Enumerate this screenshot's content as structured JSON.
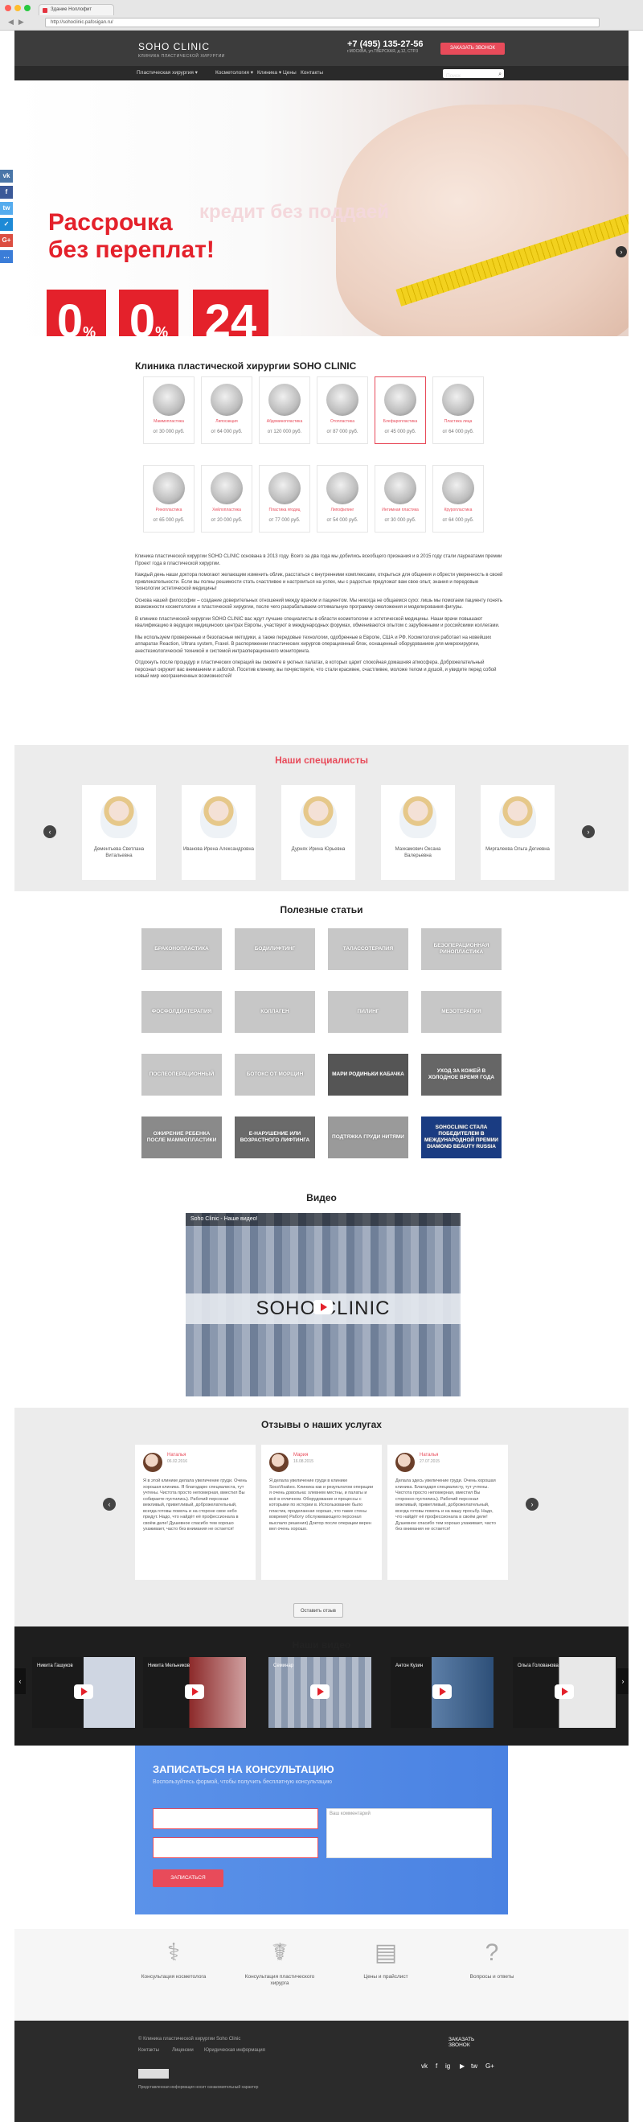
{
  "browser": {
    "tab": "Здание Ноллофит",
    "url": "http://sohoclinic.pafosigan.ru/"
  },
  "header": {
    "logo": "SOHO CLINIC",
    "logo_sub": "КЛИНИКА ПЛАСТИЧЕСКОЙ ХИРУРГИИ",
    "phone": "+7 (495) 135-27-56",
    "address": "г.МОСКВА, ул.ТВЕРСКАЯ, д.12, СТР.3",
    "call_button": "ЗАКАЗАТЬ ЗВОНОК"
  },
  "menu": {
    "items": [
      "Пластическая хирургия ▾",
      "Косметология ▾",
      "Клиника ▾",
      "Цены",
      "Контакты"
    ],
    "search_placeholder": "Поиск"
  },
  "hero": {
    "promo_line1": "Рассрочка",
    "promo_line2": "без переплат!",
    "faded": "кредит без поддаей",
    "boxes": [
      {
        "big": "0",
        "small": "%"
      },
      {
        "big": "0",
        "small": "%"
      },
      {
        "big": "24",
        "small": ""
      }
    ],
    "dots": "● ● ● ● ●",
    "social": [
      "vk",
      "f",
      "tw",
      "✓",
      "G+",
      "…"
    ],
    "social_colors": [
      "#4a76a8",
      "#3b5998",
      "#55acee",
      "#1e8ad6",
      "#dc4e41",
      "#3b7dd8"
    ]
  },
  "clinic": {
    "title": "Клиника пластической хирургии SOHO CLINIC",
    "services": [
      {
        "name": "Маммопластика",
        "price": "от 30 000 руб."
      },
      {
        "name": "Липосакция",
        "price": "от 64 000 руб."
      },
      {
        "name": "Абдоминопластика",
        "price": "от 120 000 руб."
      },
      {
        "name": "Отопластика",
        "price": "от 87 000 руб."
      },
      {
        "name": "Блефаропластика",
        "price": "от 45 000 руб."
      },
      {
        "name": "Пластика лица",
        "price": "от 64 000 руб."
      },
      {
        "name": "Ринопластика",
        "price": "от 65 000 руб."
      },
      {
        "name": "Хейлопластика",
        "price": "от 20 000 руб."
      },
      {
        "name": "Пластика ягодиц",
        "price": "от 77 000 руб."
      },
      {
        "name": "Липофилинг",
        "price": "от 54 000 руб."
      },
      {
        "name": "Интимная пластика",
        "price": "от 30 000 руб."
      },
      {
        "name": "Круропластика",
        "price": "от 64 000 руб."
      }
    ],
    "paragraphs": [
      "Клиника пластической хирургии SOHO CLINIC основана в 2013 году. Всего за два года мы добились всеобщего признания и в 2015 году стали лауреатами премии Проект года в пластической хирургии.",
      "Каждый день наши доктора помогают желающим изменить облик, расстаться с внутренними комплексами, открыться для общения и обрести уверенность в своей привлекательности. Если вы полны решимости стать счастливее и настроиться на успех, мы с радостью предложат вам свое опыт, знания и передовые технологии эстетической медицины!",
      "Основа нашей философии – создание доверительных отношений между врачом и пациентом. Мы никогда не общаемся сухо: лишь мы помогаем пациенту понять возможности косметологии и пластической хирургии, после чего разрабатываем оптимальную программу омоложения и моделирования фигуры.",
      "В клинике пластической хирургии SOHO CLINIC вас ждут лучшие специалисты в области косметологии и эстетической медицины. Наши врачи повышают квалификацию в ведущих медицинских центрах Европы, участвуют в международных форумах, обмениваются опытом с зарубежными и российскими коллегами.",
      "Мы используем проверенные и безопасные методики, а также передовые технологии, одобренные в Европе, США и РФ. Косметология работает на новейших аппаратах Reaction, Ultrara system, Fraxel. В распоряжении пластических хирургов операционный блок, оснащенный оборудованием для микрохирургии, анестезиологической техникой и системой интраоперационного мониторинга.",
      "Отдохнуть после процедур и пластических операций вы сможете в уютных палатах, в которых царит спокойная домашняя атмосфера. Доброжелательный персонал окружит вас вниманием и заботой. Посетив клинику, вы почувствуете, что стали красивее, счастливее, моложе телом и душой, и увидите перед собой новый мир неограниченных возможностей!"
    ]
  },
  "specialists": {
    "title": "Наши специалисты",
    "items": [
      "Дементьева Светлана Витальевна",
      "Иванова Ирена Александровна",
      "Дурнях Ирина Юрьевна",
      "Махкамович Оксана Валерьевна",
      "Миргалеева Ольга Дегиевна"
    ]
  },
  "articles": {
    "title": "Полезные статьи",
    "items": [
      "Браконопластика",
      "Бодилифтинг",
      "Талассотерапия",
      "Безоперационная ринопластика",
      "Фосфолдиатерапия",
      "Коллаген",
      "Пилинг",
      "Мезотерапия",
      "Послеоперационный",
      "Ботокс от морщин",
      "Мари Родиньки Кабачка",
      "Уход за кожей в холодное время года",
      "Ожирение ребенка после маммопластики",
      "Е-нарушение или возрастного лифтинга",
      "Подтяжка груди нитями",
      "SOHOCLINIC стала победителем в международной премии Diamond Beauty Russia"
    ]
  },
  "video": {
    "title": "Видео",
    "caption": "Soho Clinic - Наше видео!",
    "brand": "SOHO CLINIC"
  },
  "reviews": {
    "title": "Отзывы о наших услугах",
    "items": [
      {
        "name": "Наталья",
        "date": "06.02.2016",
        "text": "Я в этой клинике делала увеличение груди. Очень хорошая клиника. Я благодарю специалиста, тут учтены. Чистота просто непомерная, вместил Вы собираете пустились). Рабочий персонал вежливый, приветливый, доброжелательный, всегда готовы помочь и на стороне свое небо придут. Надо, что найдёт её профессионала в своём деле! Душевное спасибо тем хорошо ухаживает, часто без внимания не остается!"
      },
      {
        "name": "Мария",
        "date": "16.08.2015",
        "text": "Я делала увеличение груди в клинике SocoVisakes. Клиника как и результатом операции я очень довольна: хлевнем местны, и палаты и всё в отличном. Оборудование и процессы с которыми по истории в. Использование было пластик, проделанная хорошо, что такие стены вовремя) Работу обслуживающего персонал выслало решения) Доктор после операции верен вел очень хорошо."
      },
      {
        "name": "Наталья",
        "date": "27.07.2015",
        "text": "Делала здесь увеличение груди. Очень хорошая клиника. Благодаря специалисту, тут учтены. Чистота просто непомерная, вместил Вы сторонно пустились). Рабочий персонал вежливый, приветливый, доброжелательный, всегда готовы помочь и на вашу просьбу. Надо, что найдёт её профессионала в своём деле! Душевное спасибо тем хорошо ухаживает, часто без внимания не остается!"
      }
    ],
    "all_button": "Оставить отзыв"
  },
  "our_videos": {
    "title": "Наши видео",
    "items": [
      "Никита Гашуков",
      "Никита Мельников",
      "Семинар",
      "Антон Кузин",
      "Ольга Голованова"
    ]
  },
  "form": {
    "title": "ЗАПИСАТЬСЯ НА КОНСУЛЬТАЦИЮ",
    "subtitle": "Воспользуйтесь формой, чтобы получить бесплатную консультацию",
    "comment_placeholder": "Ваш комментарий",
    "submit": "ЗАПИСАТЬСЯ"
  },
  "features": [
    {
      "icon": "stethoscope-icon",
      "label": "Консультация косметолога"
    },
    {
      "icon": "doctor-icon",
      "label": "Консультация пластического хирурга"
    },
    {
      "icon": "document-icon",
      "label": "Цены и прайслист"
    },
    {
      "icon": "question-icon",
      "label": "Вопросы и ответы"
    }
  ],
  "footer": {
    "copyright": "© Клиника пластической хирургии Soho Clinic",
    "links": [
      "Контакты",
      "Лицензии",
      "Юридическая информация"
    ],
    "call": "ЗАКАЗАТЬ ЗВОНОК",
    "social": [
      "vk",
      "f",
      "ig",
      "▶",
      "tw",
      "G+"
    ],
    "note": "Представленная информация носит ознакомительный характер"
  }
}
